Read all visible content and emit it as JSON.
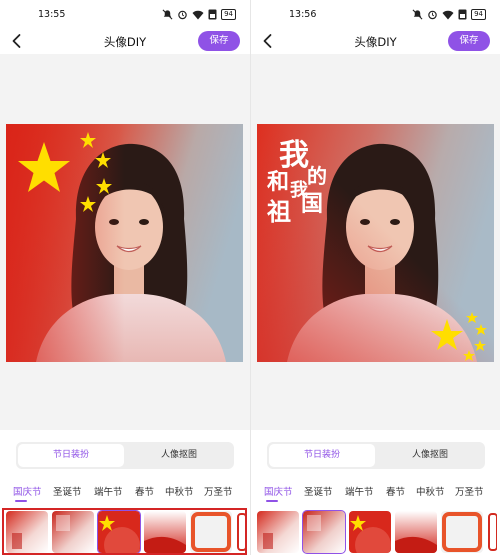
{
  "screens": [
    {
      "status": {
        "time": "13:55",
        "battery": "94"
      },
      "nav": {
        "title": "头像DIY",
        "save_label": "保存"
      },
      "photo": {
        "overlay": "flag-stars"
      },
      "segment": {
        "option_a": "节日装扮",
        "option_b": "人像抠图"
      },
      "tabs": [
        "国庆节",
        "圣诞节",
        "端午节",
        "春节",
        "中秋节",
        "万圣节"
      ],
      "active_tab_index": 0,
      "selected_thumb_index": 2,
      "highlight_frame": true
    },
    {
      "status": {
        "time": "13:56",
        "battery": "94"
      },
      "nav": {
        "title": "头像DIY",
        "save_label": "保存"
      },
      "photo": {
        "overlay": "calligraphy-stars",
        "calligraphy": [
          "我",
          "和",
          "我",
          "的",
          "祖",
          "国"
        ]
      },
      "segment": {
        "option_a": "节日装扮",
        "option_b": "人像抠图"
      },
      "tabs": [
        "国庆节",
        "圣诞节",
        "端午节",
        "春节",
        "中秋节",
        "万圣节"
      ],
      "active_tab_index": 0,
      "selected_thumb_index": 1,
      "highlight_frame": false
    }
  ],
  "colors": {
    "accent": "#8f52e6",
    "flag_red": "#de2910",
    "star_yellow": "#ffde00",
    "frame_red": "#d42525"
  },
  "icons": [
    "back-arrow-icon",
    "mute-icon",
    "alarm-icon",
    "wifi-icon",
    "battery-icon"
  ]
}
